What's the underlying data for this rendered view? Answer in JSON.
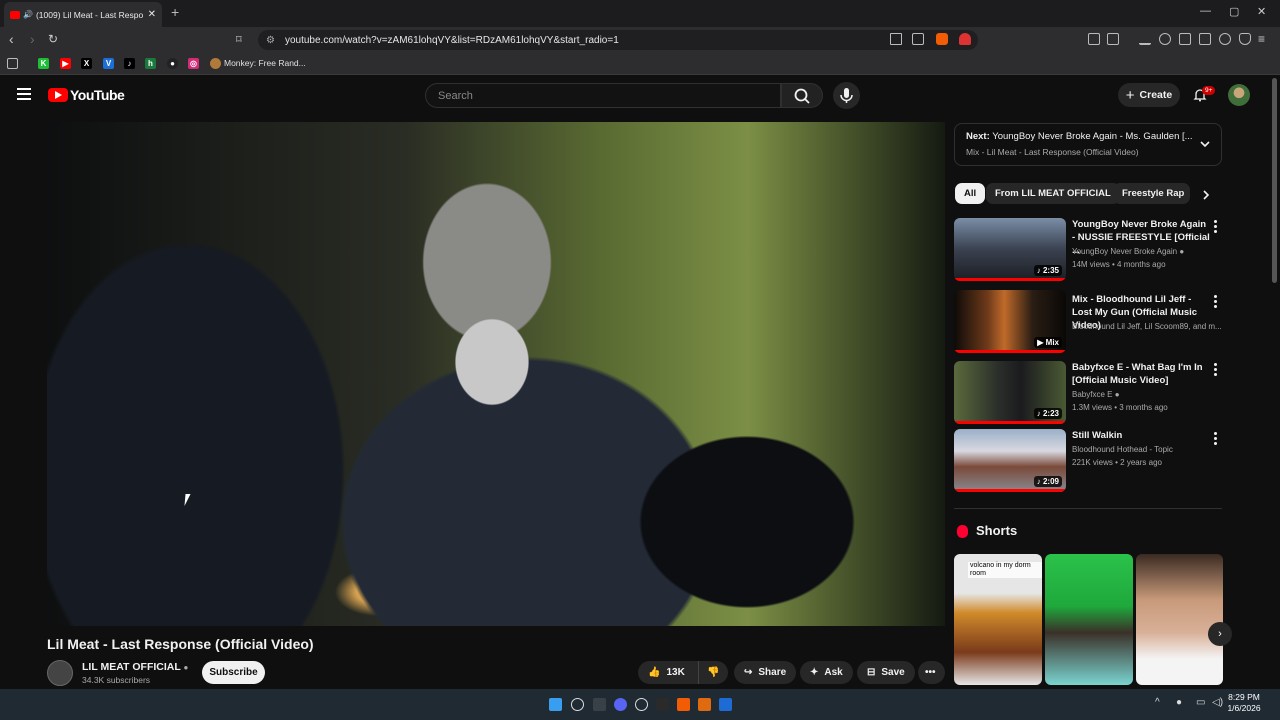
{
  "browser": {
    "tab_title": "(1009) Lil Meat - Last Respon",
    "new_tab": "+",
    "url": "youtube.com/watch?v=zAM61lohqVY&list=RDzAM61lohqVY&start_radio=1",
    "bookmark_label": "Monkey: Free Rand...",
    "window_controls": [
      "—",
      "▢",
      "✕"
    ]
  },
  "youtube": {
    "logo_text": "YouTube",
    "search_placeholder": "Search",
    "create_label": "Create",
    "notif_badge": "9+"
  },
  "video": {
    "title": "Lil Meat - Last Response (Official Video)",
    "channel": "LIL MEAT OFFICIAL",
    "subscribers": "34.3K subscribers",
    "subscribe_label": "Subscribe",
    "likes": "13K",
    "share_label": "Share",
    "ask_label": "Ask",
    "save_label": "Save"
  },
  "next_up": {
    "label": "Next:",
    "title": "YoungBoy Never Broke Again - Ms. Gaulden [...",
    "mix": "Mix - Lil Meat - Last Response (Official Video)"
  },
  "chips": [
    "All",
    "From LIL MEAT OFFICIAL",
    "Freestyle Rap"
  ],
  "recommendations": [
    {
      "title": "YoungBoy Never Broke Again - NUSSIE FREESTYLE [Official ...",
      "channel": "YoungBoy Never Broke Again",
      "meta": "14M views • 4 months ago",
      "duration": "2:35"
    },
    {
      "title": "Mix - Bloodhound Lil Jeff - Lost My Gun (Official Music Video)",
      "channel": "Bloodhound Lil Jeff, Lil Scoom89, and m...",
      "meta": "",
      "duration": "Mix"
    },
    {
      "title": "Babyfxce E - What Bag I'm In [Official Music Video]",
      "channel": "Babyfxce E",
      "meta": "1.3M views • 3 months ago",
      "duration": "2:23"
    },
    {
      "title": "Still Walkin",
      "channel": "Bloodhound Hothead - Topic",
      "meta": "221K views • 2 years ago",
      "duration": "2:09"
    }
  ],
  "shorts": {
    "title": "Shorts",
    "caption": "volcano in my dorm room"
  },
  "taskbar": {
    "time": "8:29 PM",
    "date": "1/6/2026"
  },
  "colors": {
    "accent": "#ff0000",
    "background": "#0f0f0f",
    "surface": "#272727"
  }
}
